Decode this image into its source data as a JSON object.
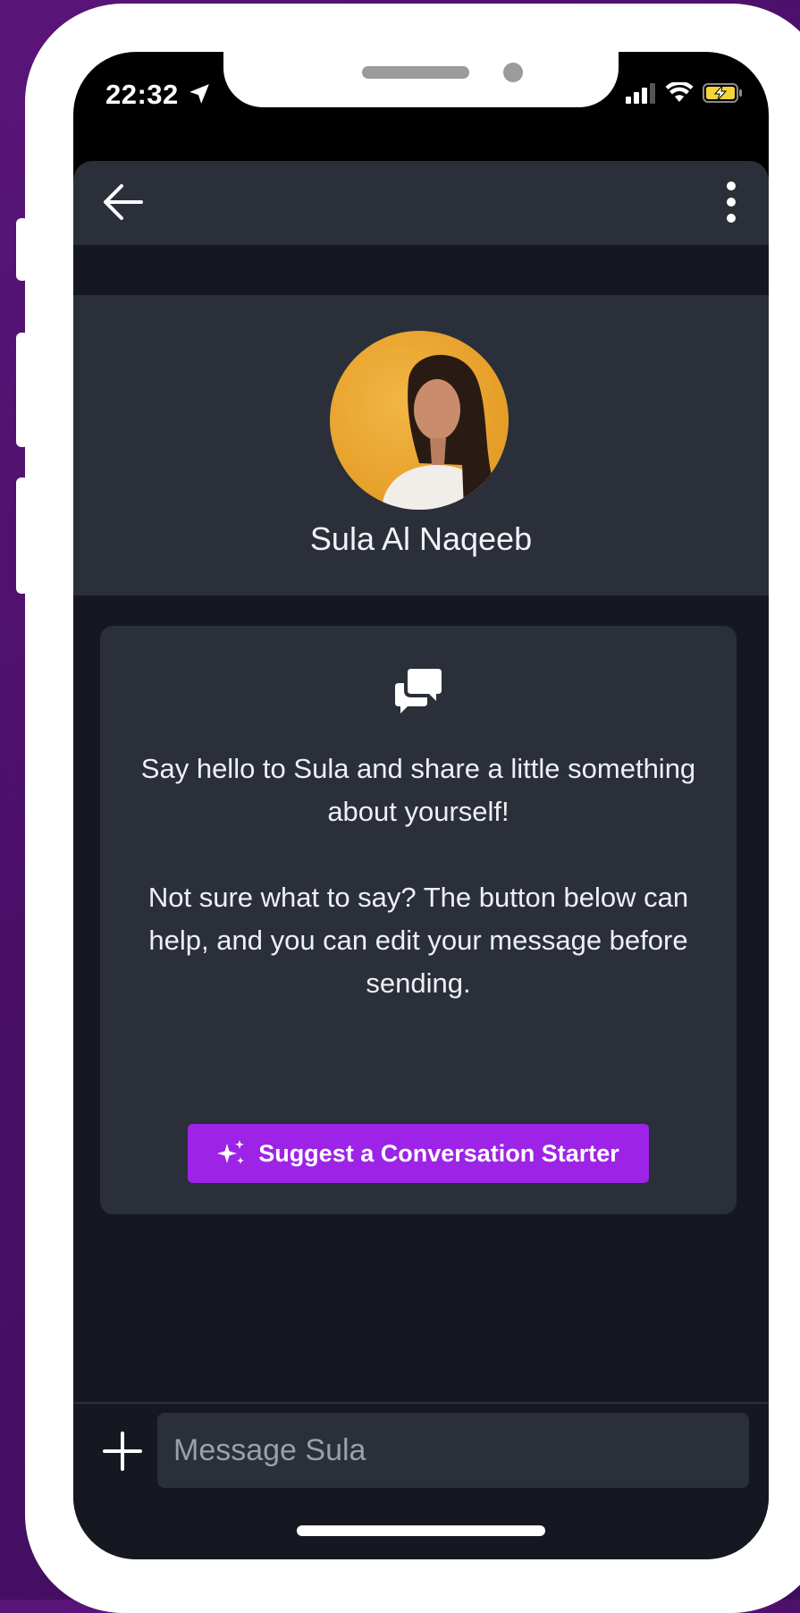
{
  "status_bar": {
    "time": "22:32"
  },
  "icons": {
    "location": "location-arrow-icon",
    "signal": "cellular-signal-icon",
    "wifi": "wifi-icon",
    "battery": "battery-charging-icon",
    "back": "back-arrow-icon",
    "more": "more-vertical-icon",
    "chat": "chat-bubbles-icon",
    "sparkle": "sparkle-icon",
    "plus": "plus-icon"
  },
  "profile": {
    "name": "Sula Al Naqeeb"
  },
  "intro_card": {
    "line1": "Say hello to Sula and share a little something about yourself!",
    "line2": "Not sure what to say? The button below can help, and you can edit your message before sending.",
    "suggest_button_label": "Suggest a Conversation Starter"
  },
  "composer": {
    "placeholder": "Message Sula"
  },
  "colors": {
    "background_purple": "#4a1068",
    "panel": "#2a2f3a",
    "app_bg": "#151821",
    "accent_button": "#9d23e6",
    "battery_yellow": "#f3d43a"
  }
}
